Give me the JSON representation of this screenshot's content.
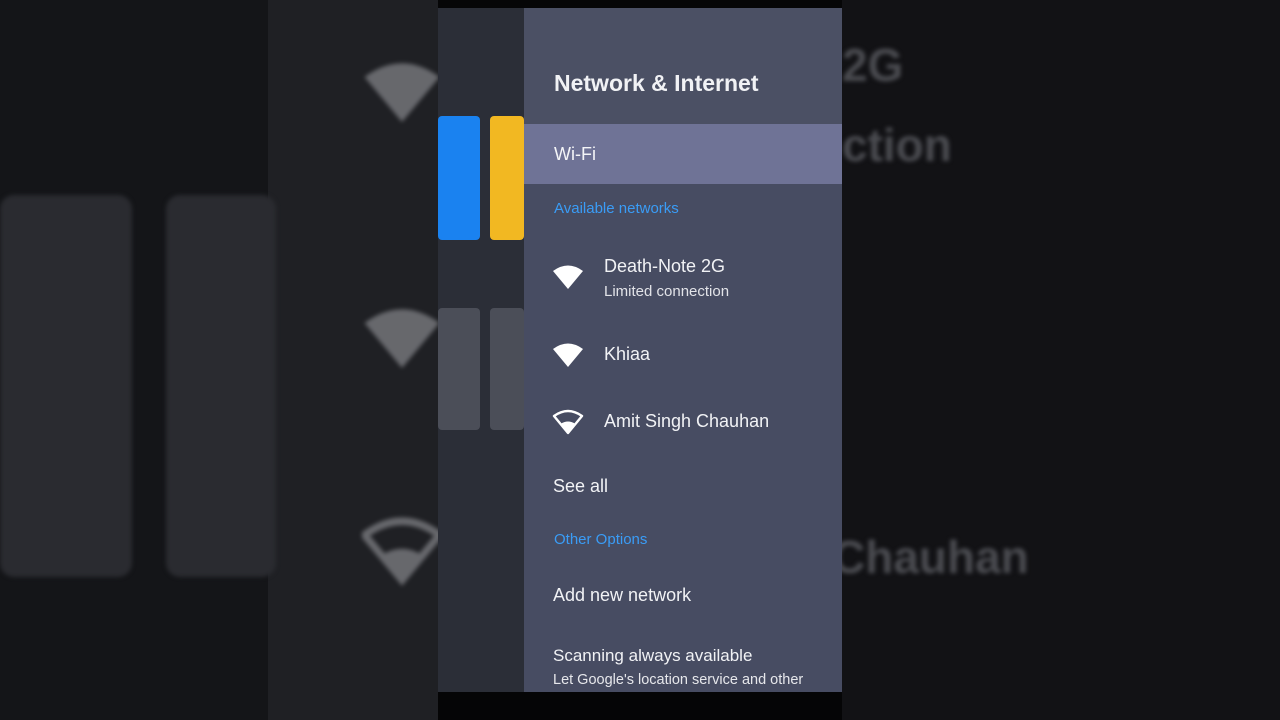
{
  "background": {
    "right_text_1": "2G",
    "right_text_2": "ction",
    "right_text_3": "Chauhan"
  },
  "panel": {
    "title": "Network & Internet",
    "selected_item": "Wi-Fi",
    "available_label": "Available networks",
    "networks": [
      {
        "name": "Death-Note 2G",
        "status": "Limited connection",
        "icon": "wifi-full-icon"
      },
      {
        "name": "Khiaa",
        "status": "",
        "icon": "wifi-full-icon"
      },
      {
        "name": "Amit Singh Chauhan",
        "status": "",
        "icon": "wifi-partial-icon"
      }
    ],
    "see_all": "See all",
    "other_label": "Other Options",
    "add_network": "Add new network",
    "scanning_title": "Scanning always available",
    "scanning_desc": "Let Google's location service and other"
  },
  "colors": {
    "accent_label": "#3a9cf6",
    "selected_row": "#6f7396",
    "panel_bg": "#474c62",
    "tile_blue": "#1a82f0",
    "tile_yellow": "#f2b822"
  }
}
